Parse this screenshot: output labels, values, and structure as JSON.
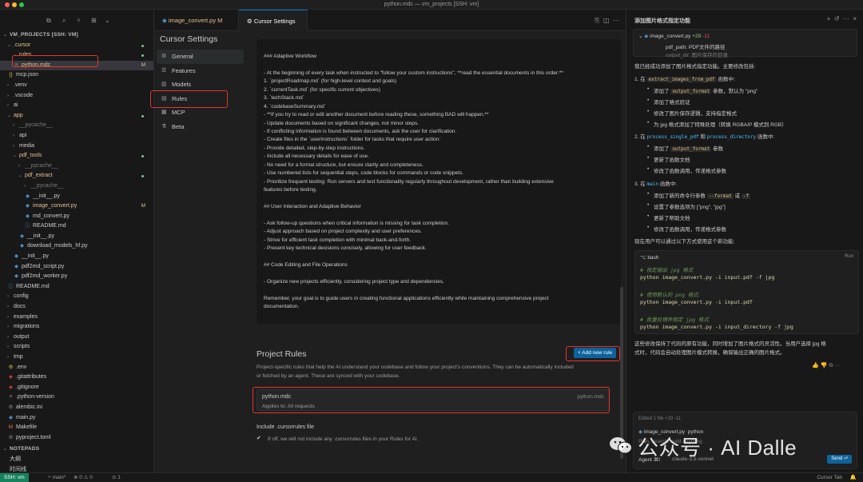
{
  "window": {
    "title": "python.mdc — vm_projects [SSH: vm]"
  },
  "explorer": {
    "root": "VM_PROJECTS [SSH: VM]",
    "items": [
      {
        "label": ".cursor",
        "indent": 1,
        "chev": "v",
        "color": "yellow",
        "dot": true
      },
      {
        "label": "rules",
        "indent": 2,
        "chev": "v",
        "color": "yellow",
        "dot": true
      },
      {
        "label": "python.mdc",
        "indent": 2,
        "icon": "≡",
        "color": "yellow",
        "badge": "M"
      },
      {
        "label": "mcp.json",
        "indent": 1,
        "icon": "{}",
        "iconColor": "#cbcb41"
      },
      {
        "label": ".venv",
        "indent": 1,
        "chev": ">"
      },
      {
        "label": ".vscode",
        "indent": 1,
        "chev": ">"
      },
      {
        "label": "ai",
        "indent": 1,
        "chev": ">"
      },
      {
        "label": "app",
        "indent": 1,
        "chev": "v",
        "color": "yellow",
        "dot": true
      },
      {
        "label": "__pycache__",
        "indent": 2,
        "chev": ">",
        "color": "muted"
      },
      {
        "label": "api",
        "indent": 2,
        "chev": ">"
      },
      {
        "label": "media",
        "indent": 2,
        "chev": ">"
      },
      {
        "label": "pdf_tools",
        "indent": 2,
        "chev": "v",
        "color": "yellow",
        "dot": true
      },
      {
        "label": "__pycache__",
        "indent": 3,
        "chev": ">",
        "color": "muted"
      },
      {
        "label": "pdf_extract",
        "indent": 3,
        "chev": "v",
        "color": "yellow",
        "dot": true
      },
      {
        "label": "__pycache__",
        "indent": 4,
        "chev": ">",
        "color": "muted"
      },
      {
        "label": "__init__.py",
        "indent": 4,
        "icon": "◆",
        "iconColor": "#4b8bbe"
      },
      {
        "label": "image_convert.py",
        "indent": 4,
        "icon": "◆",
        "iconColor": "#4b8bbe",
        "color": "yellow",
        "badge": "M"
      },
      {
        "label": "md_convert.py",
        "indent": 4,
        "icon": "◆",
        "iconColor": "#4b8bbe"
      },
      {
        "label": "README.md",
        "indent": 4,
        "icon": "ⓘ",
        "iconColor": "#519aba"
      },
      {
        "label": "__init__.py",
        "indent": 3,
        "icon": "◆",
        "iconColor": "#4b8bbe"
      },
      {
        "label": "download_models_hf.py",
        "indent": 3,
        "icon": "◆",
        "iconColor": "#4b8bbe"
      },
      {
        "label": "__init__.py",
        "indent": 2,
        "icon": "◆",
        "iconColor": "#4b8bbe"
      },
      {
        "label": "pdf2md_script.py",
        "indent": 2,
        "icon": "◆",
        "iconColor": "#4b8bbe"
      },
      {
        "label": "pdf2md_worker.py",
        "indent": 2,
        "icon": "◆",
        "iconColor": "#4b8bbe"
      },
      {
        "label": "README.md",
        "indent": 1,
        "icon": "ⓘ",
        "iconColor": "#519aba"
      },
      {
        "label": "config",
        "indent": 1,
        "chev": ">"
      },
      {
        "label": "docs",
        "indent": 1,
        "chev": ">"
      },
      {
        "label": "examples",
        "indent": 1,
        "chev": ">"
      },
      {
        "label": "migrations",
        "indent": 1,
        "chev": ">"
      },
      {
        "label": "output",
        "indent": 1,
        "chev": ">"
      },
      {
        "label": "scripts",
        "indent": 1,
        "chev": ">"
      },
      {
        "label": "tmp",
        "indent": 1,
        "chev": ">"
      },
      {
        "label": ".env",
        "indent": 1,
        "icon": "⚙",
        "iconColor": "#cbcb41"
      },
      {
        "label": ".gitattributes",
        "indent": 1,
        "icon": "◈",
        "iconColor": "#f14e32"
      },
      {
        "label": ".gitignore",
        "indent": 1,
        "icon": "◈",
        "iconColor": "#f14e32"
      },
      {
        "label": ".python-version",
        "indent": 1,
        "icon": "≡",
        "iconColor": "#8a8a8a"
      },
      {
        "label": "alembic.ini",
        "indent": 1,
        "icon": "⚙",
        "iconColor": "#8a8a8a"
      },
      {
        "label": "main.py",
        "indent": 1,
        "icon": "◆",
        "iconColor": "#4b8bbe"
      },
      {
        "label": "Makefile",
        "indent": 1,
        "icon": "M",
        "iconColor": "#e37933"
      },
      {
        "label": "pyproject.toml",
        "indent": 1,
        "icon": "⚙",
        "iconColor": "#8a8a8a"
      }
    ],
    "notepads_header": "NOTEPADS",
    "notepads": [
      "大纲",
      "时间线"
    ]
  },
  "tabs": [
    {
      "label": "image_convert.py",
      "badge": "M"
    },
    {
      "label": "Cursor Settings"
    }
  ],
  "settings": {
    "title": "Cursor Settings",
    "nav": [
      {
        "label": "General",
        "icon": "⚙"
      },
      {
        "label": "Features",
        "icon": "☰"
      },
      {
        "label": "Models",
        "icon": "▥"
      },
      {
        "label": "Rules",
        "icon": "▤"
      },
      {
        "label": "MCP",
        "icon": "▦"
      },
      {
        "label": "Beta",
        "icon": "⚗"
      }
    ],
    "rules_text": [
      "### Adaptive Workflow",
      "",
      "- At the beginning of every task when instructed to \"follow your custom instructions\", **read the essential documents in this order:**",
      "1. `projectRoadmap.md` (for high-level context and goals)",
      "2. `currentTask.md` (for specific current objectives)",
      "3. `techStack.md`",
      "4. `codebaseSummary.md`",
      "- **If you try to read or edit another document before reading these, something BAD will happen.**",
      "- Update documents based on significant changes, not minor steps.",
      "- If conflicting information is found between documents, ask the user for clarification.",
      "- Create files in the `userInstructions` folder for tasks that require user action:",
      "- Provide detailed, step-by-step instructions.",
      "- Include all necessary details for ease of use.",
      "- No need for a formal structure, but ensure clarity and completeness.",
      "- Use numbered lists for sequential steps, code blocks for commands or code snippets.",
      "- Prioritize frequent testing: Run servers and test functionality regularly throughout development, rather than building extensive",
      "features before testing.",
      "",
      "## User Interaction and Adaptive Behavior",
      "",
      "- Ask follow-up questions when critical information is missing for task completion.",
      "- Adjust approach based on project complexity and user preferences.",
      "- Strive for efficient task completion with minimal back-and-forth.",
      "- Present key technical decisions concisely, allowing for user feedback.",
      "",
      "## Code Editing and File Operations",
      "",
      "- Organize new projects efficiently, considering project type and dependencies.",
      "",
      "Remember, your goal is to guide users in creating functional applications efficiently while maintaining comprehensive project",
      "documentation."
    ],
    "project_rules": {
      "title": "Project Rules",
      "description_line1": "Project-specific rules that help the AI understand your codebase and follow your project's conventions. They can be automatically included",
      "description_line2": "or fetched by an agent. These are synced with your codebase.",
      "add_button": "+ Add new rule",
      "rule": {
        "name": "python.mdc",
        "right": "python.mdc",
        "applies": "Applies to: All requests"
      },
      "include_title": "Include .cursorrules file",
      "include_desc": "If off, we will not include any .cursorrules files in your Rules for AI."
    }
  },
  "chat": {
    "title": "添加图片格式指定功能",
    "diff": {
      "file": "image_convert.py",
      "added": "+29",
      "removed": "-11",
      "line1": "pdf_path: PDF文件的路径",
      "line2": "output_dir: 图片保存的目录"
    },
    "intro": "我已经成功添加了图片格式指定功能。主要修改包括:",
    "s1": {
      "num": "1. 在",
      "code": "extract_images_from_pdf",
      "rest": "函数中:"
    },
    "s1_b1": {
      "pre": "添加了",
      "code": "output_format",
      "post": "参数，默认为 \"png\""
    },
    "s1_b2": "添加了格式验证",
    "s1_b3": "修改了图片保存逻辑，支持指定格式",
    "s1_b4": "为 jpg 格式添加了特殊处理（转换 RGBA/P 模式到 RGB）",
    "s2": {
      "num": "2. 在",
      "code1": "process_single_pdf",
      "and": "和",
      "code2": "process_directory",
      "rest": "函数中:"
    },
    "s2_b1": {
      "pre": "添加了",
      "code": "output_format",
      "post": "参数"
    },
    "s2_b2": "更新了函数文档",
    "s2_b3": "修改了函数调用，传递格式参数",
    "s3": {
      "num": "3. 在",
      "code": "main",
      "rest": "函数中:"
    },
    "s3_b1": {
      "pre": "添加了新的命令行参数",
      "code1": "--format",
      "or": "或",
      "code2": "-f"
    },
    "s3_b2": "设置了参数选项为 [\"png\", \"jpg\"]",
    "s3_b3": "更新了帮助文档",
    "s3_b4": "修改了函数调用，传递格式参数",
    "usage": "现在用户可以通过以下方式使用这个新功能:",
    "code": {
      "lang": "bash",
      "run": "Run",
      "c1": "# 指定输出 jpg 格式",
      "l1": "python image_convert.py -i input.pdf -f jpg",
      "c2": "# 使用默认的 png 格式",
      "l2": "python image_convert.py -i input.pdf",
      "c3": "# 批量处理并指定 jpg 格式",
      "l3": "python image_convert.py -i input_directory -f jpg"
    },
    "summary1": "这些修改保持了代码的原有功能，同时增加了图片格式的灵活性。当用户选择 jpg 格",
    "summary2": "式时，代码会自动处理图片模式转换，确保输出正确的图片格式。",
    "footer": {
      "edited": "Edited 1 file +29 -11",
      "file": "image_convert.py",
      "lang": "python",
      "placeholder": "Plan, search, build anything",
      "mode": "Agent ⌘I",
      "model": "claude-3.5-sonnet",
      "send": "Send ⏎"
    }
  },
  "watermark": "公众号 · AI Dalle",
  "statusbar": {
    "ssh": "SSH: vm",
    "branch": "main*",
    "problems": "⊗ 0 ⚠ 0",
    "ports": "1",
    "right": "Cursor Tab"
  }
}
